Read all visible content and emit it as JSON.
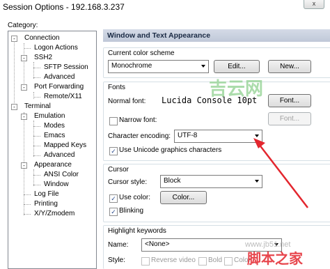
{
  "window": {
    "title": "Session Options - 192.168.3.237",
    "close_glyph": "x"
  },
  "category_label": "Category:",
  "tree": {
    "connection": "Connection",
    "logon_actions": "Logon Actions",
    "ssh2": "SSH2",
    "sftp_session": "SFTP Session",
    "ssh2_advanced": "Advanced",
    "port_forwarding": "Port Forwarding",
    "remote_x11": "Remote/X11",
    "terminal": "Terminal",
    "emulation": "Emulation",
    "modes": "Modes",
    "emacs": "Emacs",
    "mapped_keys": "Mapped Keys",
    "emulation_advanced": "Advanced",
    "appearance": "Appearance",
    "ansi_color": "ANSI Color",
    "window": "Window",
    "log_file": "Log File",
    "printing": "Printing",
    "xyzmodem": "X/Y/Zmodem",
    "expand_minus": "-"
  },
  "panel_title": "Window and Text Appearance",
  "color_scheme": {
    "label": "Current color scheme",
    "value": "Monochrome",
    "edit_button": "Edit...",
    "new_button": "New..."
  },
  "fonts": {
    "label": "Fonts",
    "normal_font_label": "Normal font:",
    "normal_font_value": "Lucida Console 10pt",
    "font_button": "Font...",
    "narrow_font_label": "Narrow font:",
    "narrow_font_button": "Font...",
    "encoding_label": "Character encoding:",
    "encoding_value": "UTF-8",
    "unicode_label": "Use Unicode graphics characters",
    "narrow_checked": false,
    "unicode_checked": true
  },
  "cursor": {
    "label": "Cursor",
    "style_label": "Cursor style:",
    "style_value": "Block",
    "use_color_label": "Use color:",
    "color_button": "Color...",
    "blinking_label": "Blinking",
    "use_color_checked": true,
    "blinking_checked": true
  },
  "highlight": {
    "label": "Highlight keywords",
    "name_label": "Name:",
    "name_value": "<None>",
    "style_label": "Style:",
    "reverse_video": "Reverse video",
    "bold": "Bold",
    "color": "Color"
  },
  "check_glyph": "✓",
  "watermark": {
    "logo": "吉云网",
    "site": "www.jb51.net",
    "brand": "脚本之家"
  },
  "colors": {
    "header_bg": "#c9d1e0",
    "group_border": "#d5dfe5",
    "arrow": "#e3262e",
    "watermark_green": "#8fd18f"
  }
}
